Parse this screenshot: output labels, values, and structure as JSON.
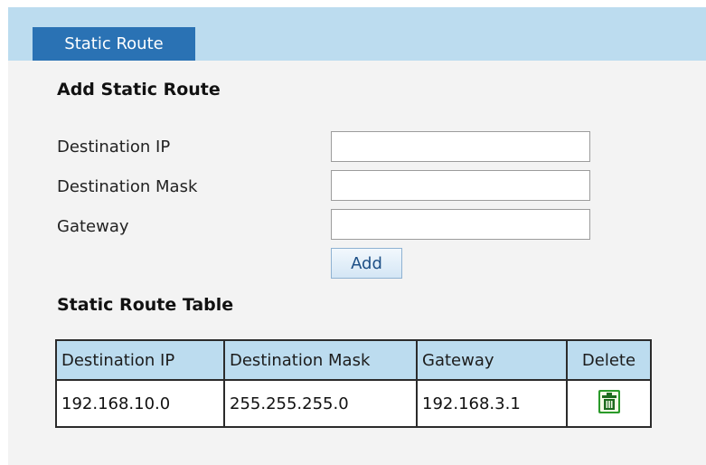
{
  "tab": {
    "label": "Static Route"
  },
  "add_section": {
    "title": "Add Static Route",
    "fields": {
      "destination_ip": {
        "label": "Destination IP",
        "value": ""
      },
      "destination_mask": {
        "label": "Destination Mask",
        "value": ""
      },
      "gateway": {
        "label": "Gateway",
        "value": ""
      }
    },
    "add_button": "Add"
  },
  "table_section": {
    "title": "Static Route Table",
    "columns": [
      "Destination IP",
      "Destination Mask",
      "Gateway",
      "Delete"
    ],
    "rows": [
      {
        "destination_ip": "192.168.10.0",
        "destination_mask": "255.255.255.0",
        "gateway": "192.168.3.1",
        "delete_icon": "trash-icon"
      }
    ]
  },
  "colors": {
    "tab_active": "#2a72b4",
    "tab_bar": "#bcdcef",
    "panel_background": "#f3f3f3",
    "table_header": "#bcdcef",
    "trash_icon": "#2a9a2a"
  }
}
